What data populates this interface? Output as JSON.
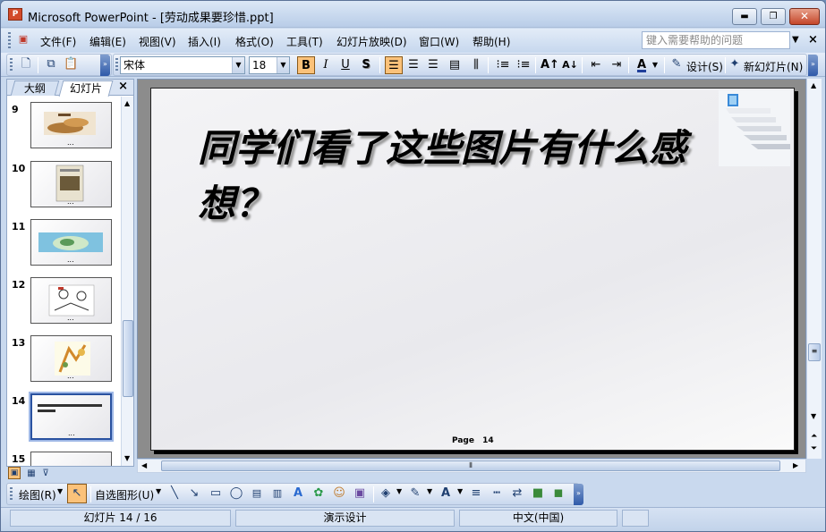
{
  "window": {
    "title": "Microsoft PowerPoint - [劳动成果要珍惜.ppt]",
    "app_icon_text": "P",
    "btn_minimize": "▬",
    "btn_restore": "❐",
    "btn_close": "✕"
  },
  "menu": {
    "items": [
      "文件(F)",
      "编辑(E)",
      "视图(V)",
      "插入(I)",
      "格式(O)",
      "工具(T)",
      "幻灯片放映(D)",
      "窗口(W)",
      "帮助(H)"
    ],
    "help_placeholder": "键入需要帮助的问题",
    "close_glyph": "×"
  },
  "toolbar": {
    "font_name": "宋体",
    "font_size": "18",
    "bold": "B",
    "italic": "I",
    "underline": "U",
    "shadow": "S",
    "design_label": "设计(S)",
    "new_slide_label": "新幻灯片(N)"
  },
  "left_pane": {
    "tabs": [
      "大纲",
      "幻灯片"
    ],
    "close_glyph": "×",
    "slides": [
      {
        "num": "9"
      },
      {
        "num": "10"
      },
      {
        "num": "11"
      },
      {
        "num": "12"
      },
      {
        "num": "13"
      },
      {
        "num": "14"
      },
      {
        "num": "15"
      }
    ],
    "selected_index": 5
  },
  "slide": {
    "title": "同学们看了这些图片有什么感想？",
    "footer_label": "Page",
    "footer_number": "14"
  },
  "drawing_toolbar": {
    "draw_label": "绘图(R)",
    "autoshapes_label": "自选图形(U)"
  },
  "statusbar": {
    "slide_position": "幻灯片 14 / 16",
    "design_name": "演示设计",
    "language": "中文(中国)"
  },
  "colors": {
    "accent": "#2a52a0",
    "toggle_active": "#fbc27a",
    "chrome": "#c9d9ee"
  }
}
